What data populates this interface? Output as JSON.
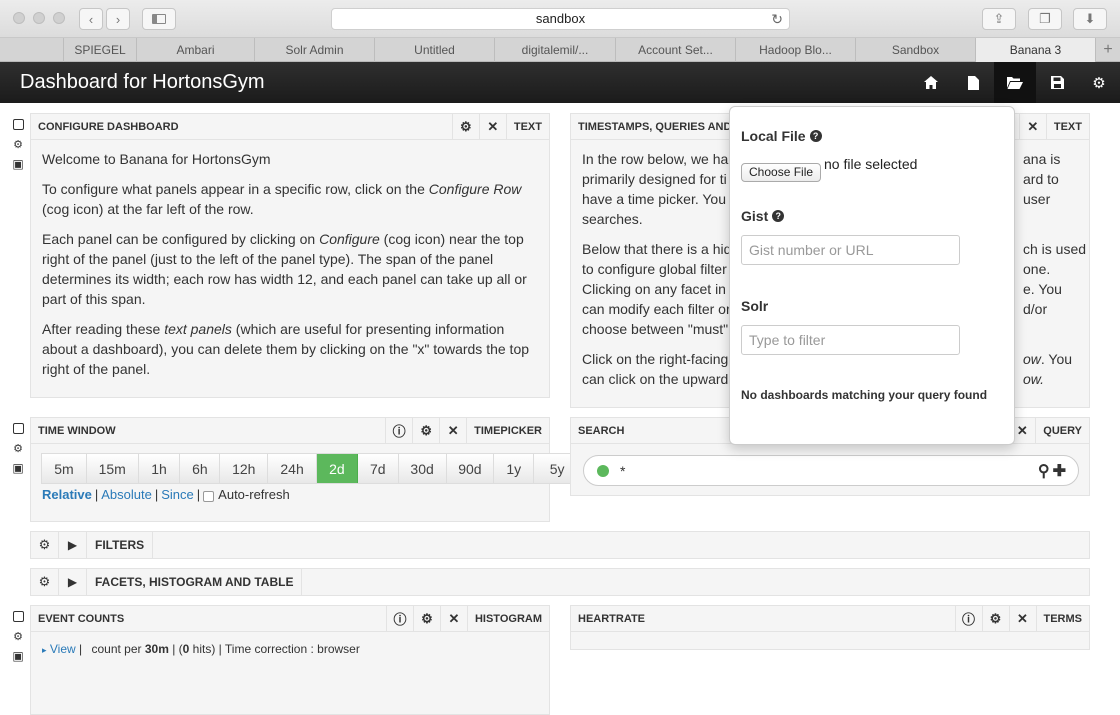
{
  "browser": {
    "address": "sandbox",
    "tabs": [
      "",
      "SPIEGEL",
      "Ambari",
      "Solr Admin",
      "Untitled",
      "digitalemil/...",
      "Account Set...",
      "Hadoop Blo...",
      "Sandbox",
      "Banana 3",
      "+"
    ]
  },
  "navbar": {
    "title": "Dashboard for HortonsGym"
  },
  "configure_panel": {
    "title": "CONFIGURE DASHBOARD",
    "type": "TEXT",
    "p1": "Welcome to Banana for HortonsGym",
    "p2a": "To configure what panels appear in a specific row, click on the ",
    "p2em": "Configure Row",
    "p2b": " (cog icon) at the far left of the row.",
    "p3a": "Each panel can be configured by clicking on ",
    "p3em": "Configure",
    "p3b": " (cog icon) near the top right of the panel (just to the left of the panel type). The span of the panel determines its width; each row has width 12, and each panel can take up all or part of this span.",
    "p4a": "After reading these ",
    "p4em": "text panels",
    "p4b": " (which are useful for presenting information about a dashboard), you can delete them by clicking on the \"x\" towards the top right of the panel."
  },
  "timestamps_panel": {
    "title": "TIMESTAMPS, QUERIES AND FI",
    "type": "TEXT",
    "l1": "In the row below, we ha",
    "l1r": "ana is",
    "l2": "primarily designed for ti",
    "l2r": "ard to",
    "l3": "have a time picker. You",
    "l3r": "user",
    "l4": "searches.",
    "l5": "Below that there is a hid",
    "l5r": "ch is used",
    "l6": "to configure global filter",
    "l6r": "one.",
    "l7": "Clicking on any facet in",
    "l7r": "e. You",
    "l8": "can modify each filter or",
    "l8r": "d/or",
    "l9": "choose between \"must\"",
    "l10": "Click on the right-facing",
    "l10r": "ow",
    "l10p": ". You",
    "l11": "can click on the upward",
    "l11r": "ow."
  },
  "time_window": {
    "title": "TIME WINDOW",
    "type": "TIMEPICKER",
    "options": [
      "5m",
      "15m",
      "1h",
      "6h",
      "12h",
      "24h",
      "2d",
      "7d",
      "30d",
      "90d",
      "1y",
      "5y"
    ],
    "active": "2d",
    "mode_relative": "Relative",
    "mode_absolute": "Absolute",
    "mode_since": "Since",
    "sep": "|",
    "autorefresh": "Auto-refresh"
  },
  "search_panel": {
    "title": "SEARCH",
    "type": "QUERY",
    "query": "*"
  },
  "filters_row": {
    "title": "FILTERS"
  },
  "facets_row": {
    "title": "FACETS, HISTOGRAM AND TABLE"
  },
  "event_counts": {
    "title": "EVENT COUNTS",
    "type": "HISTOGRAM",
    "view": "View",
    "info_a": "count per ",
    "interval": "30m",
    "info_b": " | (",
    "hits": "0",
    "info_c": " hits) | Time correction : browser"
  },
  "heartrate": {
    "title": "HEARTRATE",
    "type": "TERMS"
  },
  "load_popover": {
    "local_file": "Local File",
    "choose_file": "Choose File",
    "no_file": "no file selected",
    "gist": "Gist",
    "gist_placeholder": "Gist number or URL",
    "solr": "Solr",
    "solr_placeholder": "Type to filter",
    "message": "No dashboards matching your query found"
  }
}
